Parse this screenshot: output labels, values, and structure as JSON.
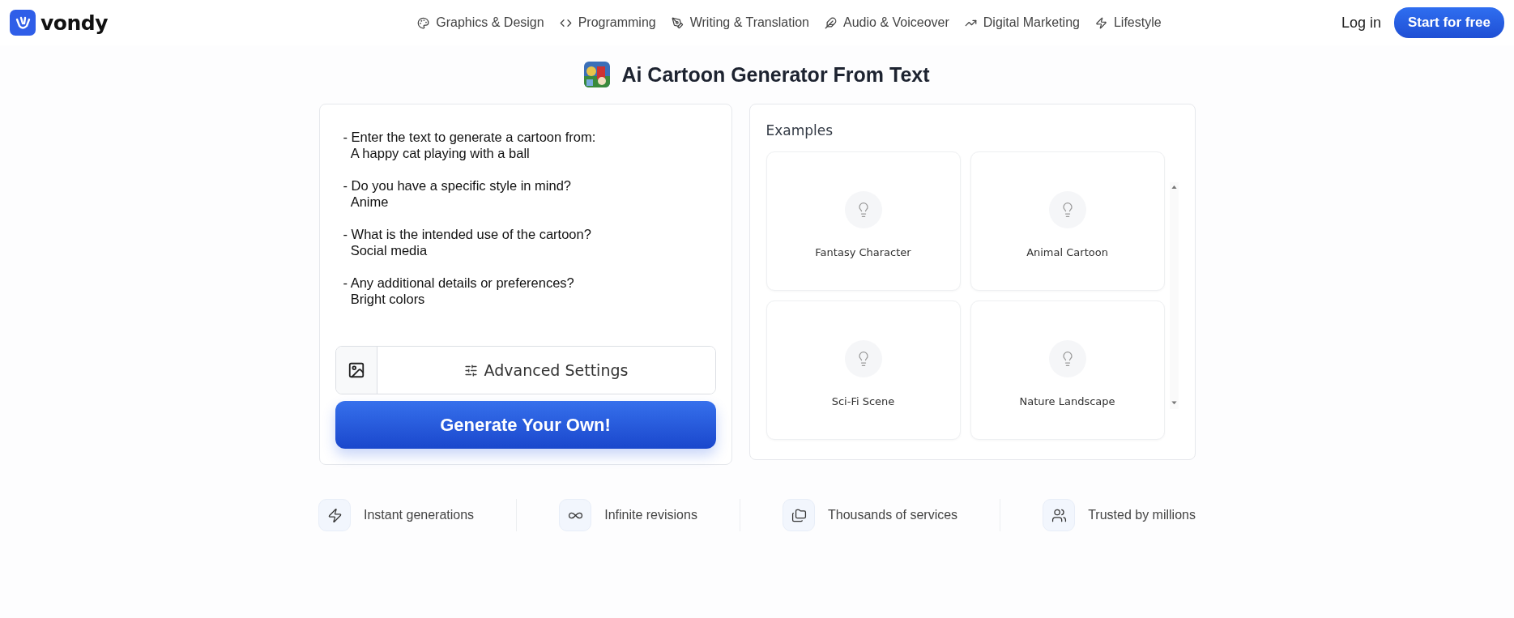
{
  "header": {
    "logo": "vondy",
    "nav": [
      {
        "label": "Graphics & Design"
      },
      {
        "label": "Programming"
      },
      {
        "label": "Writing & Translation"
      },
      {
        "label": "Audio & Voiceover"
      },
      {
        "label": "Digital Marketing"
      },
      {
        "label": "Lifestyle"
      }
    ],
    "login": "Log in",
    "cta": "Start for free"
  },
  "title": "Ai Cartoon Generator From Text",
  "prompt": {
    "value": "- Enter the text to generate a cartoon from:\n  A happy cat playing with a ball\n\n- Do you have a specific style in mind?\n  Anime\n\n- What is the intended use of the cartoon?\n  Social media\n\n- Any additional details or preferences?\n  Bright colors"
  },
  "advanced_settings": "Advanced Settings",
  "generate_button": "Generate Your Own!",
  "examples": {
    "title": "Examples",
    "items": [
      {
        "label": "Fantasy Character"
      },
      {
        "label": "Animal Cartoon"
      },
      {
        "label": "Sci-Fi Scene"
      },
      {
        "label": "Nature Landscape"
      }
    ]
  },
  "features": [
    {
      "label": "Instant generations"
    },
    {
      "label": "Infinite revisions"
    },
    {
      "label": "Thousands of services"
    },
    {
      "label": "Trusted by millions"
    }
  ]
}
